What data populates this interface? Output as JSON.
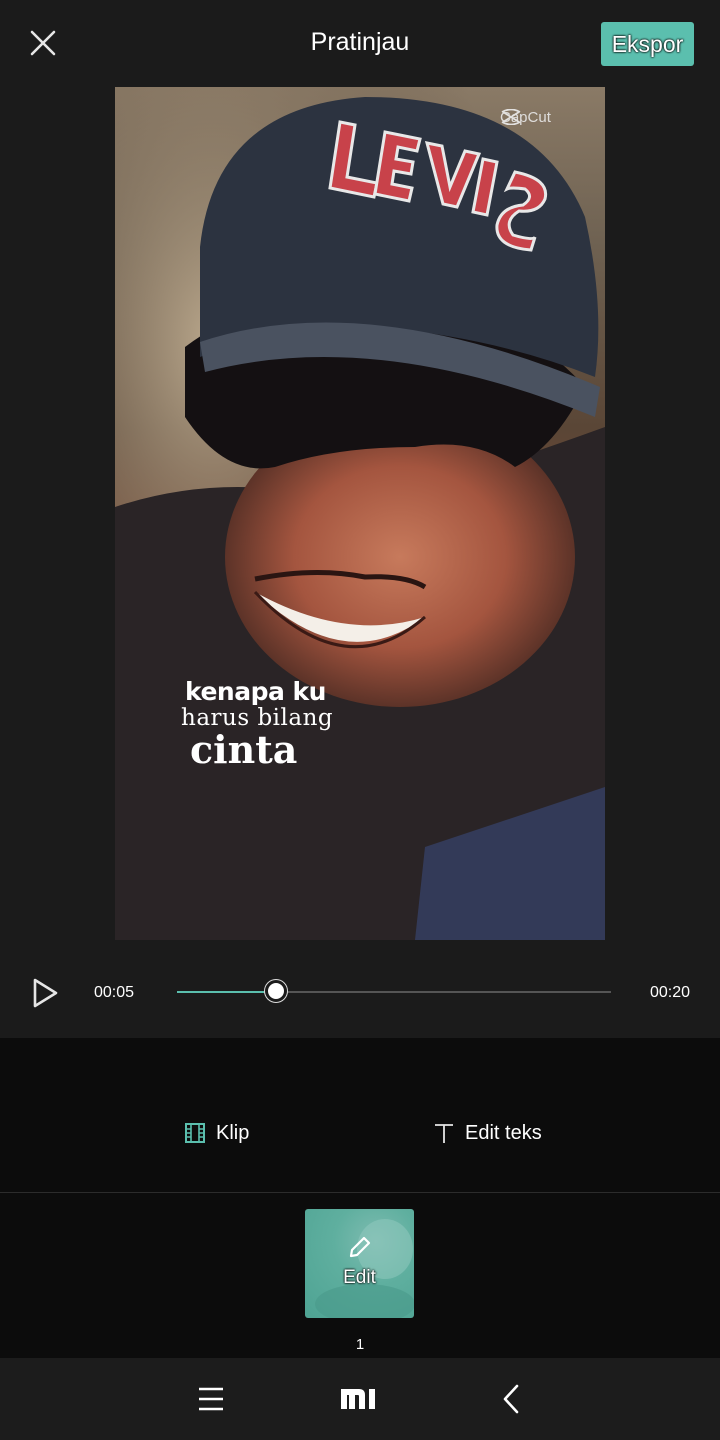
{
  "header": {
    "title": "Pratinjau",
    "export_label": "Ekspor",
    "close_icon": "close-icon"
  },
  "preview": {
    "watermark": "CapCut",
    "caption": {
      "line1": "kenapa ku",
      "line2": "harus bilang",
      "line3": "cinta"
    }
  },
  "playback": {
    "current_time": "00:05",
    "total_time": "00:20",
    "progress": 0.227,
    "accent_color": "#5bbfae"
  },
  "tabs": {
    "clip_label": "Klip",
    "edit_text_label": "Edit teks"
  },
  "clips": [
    {
      "label": "Edit",
      "number": "1"
    }
  ],
  "navbar": {
    "menu_icon": "menu-icon",
    "home_icon": "mi-home-icon",
    "back_icon": "back-icon"
  }
}
